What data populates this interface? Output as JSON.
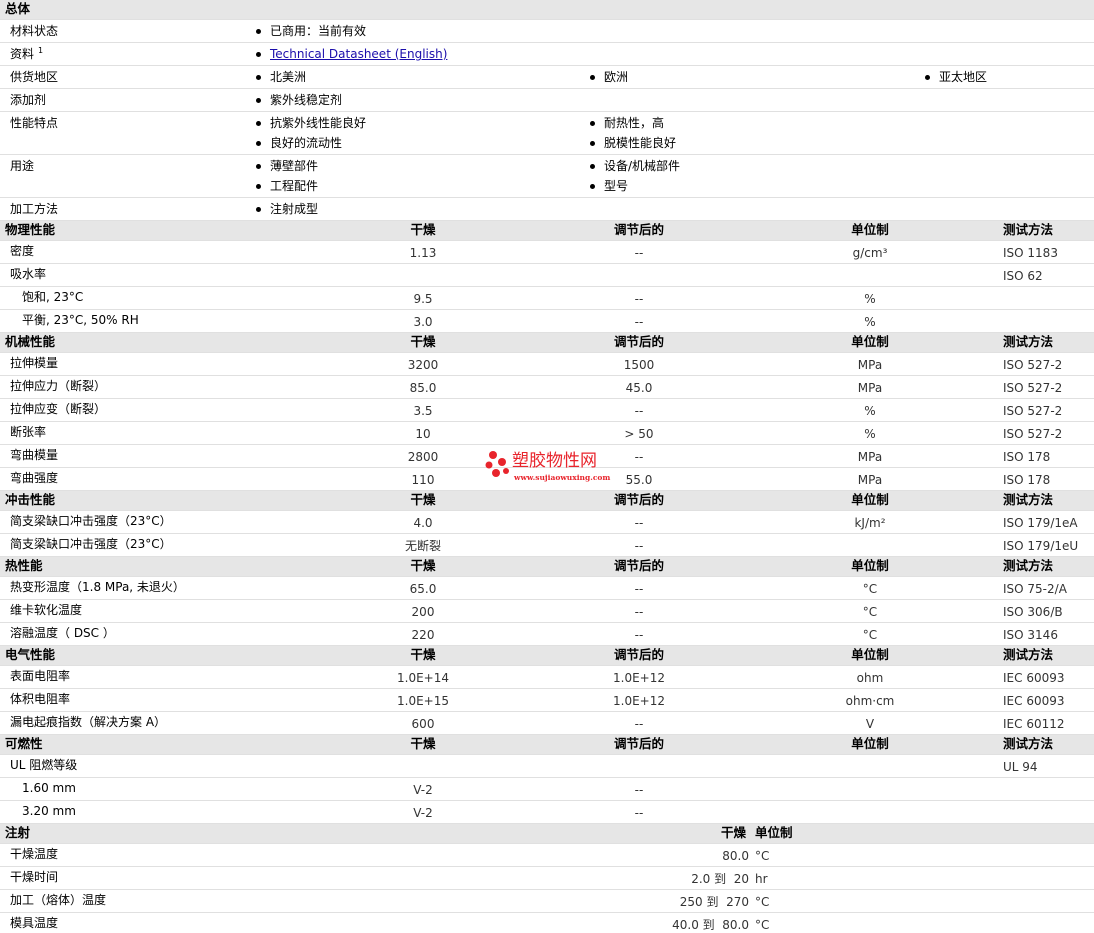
{
  "general": {
    "heading": "总体",
    "rows": [
      {
        "label": "材料状态",
        "items": [
          "已商用：当前有效"
        ]
      },
      {
        "label": "资料",
        "sup": "1",
        "link": "Technical Datasheet (English)"
      },
      {
        "label": "供货地区",
        "items": [
          "北美洲",
          "欧洲",
          "亚太地区"
        ]
      },
      {
        "label": "添加剂",
        "items": [
          "紫外线稳定剂"
        ]
      },
      {
        "label": "性能特点",
        "items": [
          "抗紫外线性能良好",
          "耐热性，高",
          "良好的流动性",
          "脱模性能良好"
        ]
      },
      {
        "label": "用途",
        "items": [
          "薄壁部件",
          "设备/机械部件",
          "工程配件",
          "型号"
        ]
      },
      {
        "label": "加工方法",
        "items": [
          "注射成型"
        ]
      }
    ]
  },
  "cols": {
    "dry": "干燥",
    "cond": "调节后的",
    "unit": "单位制",
    "method": "测试方法"
  },
  "physical": {
    "heading": "物理性能",
    "rows": [
      {
        "name": "密度",
        "dry": "1.13",
        "cond": "--",
        "unit": "g/cm³",
        "method": "ISO 1183"
      },
      {
        "name": "吸水率",
        "dry": "",
        "cond": "",
        "unit": "",
        "method": "ISO 62"
      },
      {
        "name": "饱和, 23°C",
        "dry": "9.5",
        "cond": "--",
        "unit": "%",
        "method": ""
      },
      {
        "name": "平衡, 23°C, 50% RH",
        "dry": "3.0",
        "cond": "--",
        "unit": "%",
        "method": ""
      }
    ]
  },
  "mechanical": {
    "heading": "机械性能",
    "rows": [
      {
        "name": "拉伸模量",
        "dry": "3200",
        "cond": "1500",
        "unit": "MPa",
        "method": "ISO 527-2"
      },
      {
        "name": "拉伸应力（断裂）",
        "dry": "85.0",
        "cond": "45.0",
        "unit": "MPa",
        "method": "ISO 527-2"
      },
      {
        "name": "拉伸应变（断裂）",
        "dry": "3.5",
        "cond": "--",
        "unit": "%",
        "method": "ISO 527-2"
      },
      {
        "name": "断张率",
        "dry": "10",
        "cond": "> 50",
        "unit": "%",
        "method": "ISO 527-2"
      },
      {
        "name": "弯曲模量",
        "dry": "2800",
        "cond": "--",
        "unit": "MPa",
        "method": "ISO 178"
      },
      {
        "name": "弯曲强度",
        "dry": "110",
        "cond": "55.0",
        "unit": "MPa",
        "method": "ISO 178"
      }
    ]
  },
  "impact": {
    "heading": "冲击性能",
    "rows": [
      {
        "name": "简支梁缺口冲击强度（23°C）",
        "dry": "4.0",
        "cond": "--",
        "unit": "kJ/m²",
        "method": "ISO 179/1eA"
      },
      {
        "name": "简支梁缺口冲击强度（23°C）",
        "dry": "无断裂",
        "cond": "--",
        "unit": "",
        "method": "ISO 179/1eU"
      }
    ]
  },
  "thermal": {
    "heading": "热性能",
    "rows": [
      {
        "name": "热变形温度（1.8 MPa, 未退火）",
        "dry": "65.0",
        "cond": "--",
        "unit": "°C",
        "method": "ISO 75-2/A"
      },
      {
        "name": "维卡软化温度",
        "dry": "200",
        "cond": "--",
        "unit": "°C",
        "method": "ISO 306/B"
      },
      {
        "name": "溶融温度（ DSC ）",
        "dry": "220",
        "cond": "--",
        "unit": "°C",
        "method": "ISO 3146"
      }
    ]
  },
  "electrical": {
    "heading": "电气性能",
    "rows": [
      {
        "name": "表面电阻率",
        "dry": "1.0E+14",
        "cond": "1.0E+12",
        "unit": "ohm",
        "method": "IEC 60093"
      },
      {
        "name": "体积电阻率",
        "dry": "1.0E+15",
        "cond": "1.0E+12",
        "unit": "ohm·cm",
        "method": "IEC 60093"
      },
      {
        "name": "漏电起痕指数（解决方案 A）",
        "dry": "600",
        "cond": "--",
        "unit": "V",
        "method": "IEC 60112"
      }
    ]
  },
  "flammability": {
    "heading": "可燃性",
    "rows": [
      {
        "name": "UL 阻燃等级",
        "dry": "",
        "cond": "",
        "unit": "",
        "method": "UL 94"
      },
      {
        "name": "1.60 mm",
        "dry": "V-2",
        "cond": "--",
        "unit": "",
        "method": ""
      },
      {
        "name": "3.20 mm",
        "dry": "V-2",
        "cond": "--",
        "unit": "",
        "method": ""
      }
    ]
  },
  "injection": {
    "heading": "注射",
    "col_dry": "干燥",
    "col_unit": "单位制",
    "rows": [
      {
        "name": "干燥温度",
        "value": "80.0",
        "unit": "°C"
      },
      {
        "name": "干燥时间",
        "value": "2.0 到  20",
        "unit": "hr"
      },
      {
        "name": "加工（熔体）温度",
        "value": "250 到  270",
        "unit": "°C"
      },
      {
        "name": "模具温度",
        "value": "40.0 到  80.0",
        "unit": "°C"
      }
    ]
  },
  "watermark": {
    "text": "塑胶物性网",
    "url": "www.sujiaowuxing.com",
    "color": "#e8242c"
  }
}
